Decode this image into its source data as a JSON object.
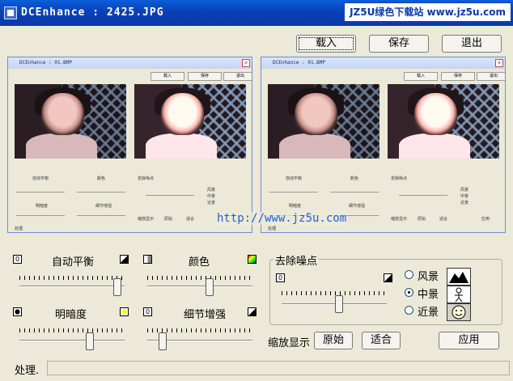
{
  "window": {
    "title": "DCEnhance : 2425.JPG",
    "watermark": "JZ5U绿色下载站 www.jz5u.com"
  },
  "toolbar": {
    "load_label": "载入",
    "save_label": "保存",
    "exit_label": "退出"
  },
  "preview": {
    "title": "DCEnhance : 01.BMP",
    "load": "载入",
    "save": "保存",
    "exit": "退出",
    "mini_awb": "自动平衡",
    "mini_color": "颜色",
    "mini_denoise": "去除噪点",
    "mini_brightness": "明暗度",
    "mini_detail": "细节增强",
    "mini_zoom": "缩放显示",
    "mini_orig": "原始",
    "mini_fit": "适合",
    "mini_apply": "应用",
    "mini_status": "处理",
    "mini_landscape": "风景",
    "mini_mid": "中景",
    "mini_near": "近景"
  },
  "url_watermark": "http://www.jz5u.com",
  "controls": {
    "auto_balance_label": "自动平衡",
    "color_label": "颜色",
    "brightness_label": "明暗度",
    "detail_label": "细节增强",
    "zero_a": "0",
    "zero_b": "0",
    "zero_c": "0",
    "auto_balance_value": 0.97,
    "color_value": 0.6,
    "brightness_value": 0.68,
    "detail_value": 0.12
  },
  "denoise": {
    "title": "去除噪点",
    "zero": "0",
    "value": 0.55,
    "options": [
      "风景",
      "中景",
      "近景"
    ],
    "selected": "中景"
  },
  "zoom": {
    "label": "缩放显示",
    "original_label": "原始",
    "fit_label": "适合"
  },
  "apply_label": "应用",
  "status": {
    "label": "处理."
  }
}
